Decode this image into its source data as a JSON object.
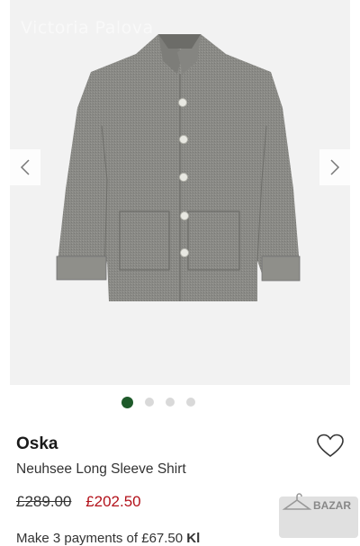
{
  "gallery": {
    "watermark": "Victoria Palova",
    "prev_icon": "chevron-left-icon",
    "next_icon": "chevron-right-icon",
    "dots": [
      true,
      false,
      false,
      false
    ],
    "active_color": "#1e5a2a"
  },
  "product": {
    "brand": "Oska",
    "name": "Neuhsee Long Sleeve Shirt",
    "original_price": "£289.00",
    "sale_price": "£202.50",
    "installments_text": "Make 3 payments of £67.50",
    "installments_provider": "Kl",
    "wishlist_icon": "heart-outline-icon",
    "sale_color": "#b3121b"
  },
  "badge": {
    "text": "BAZAR",
    "icon": "hanger-icon"
  }
}
